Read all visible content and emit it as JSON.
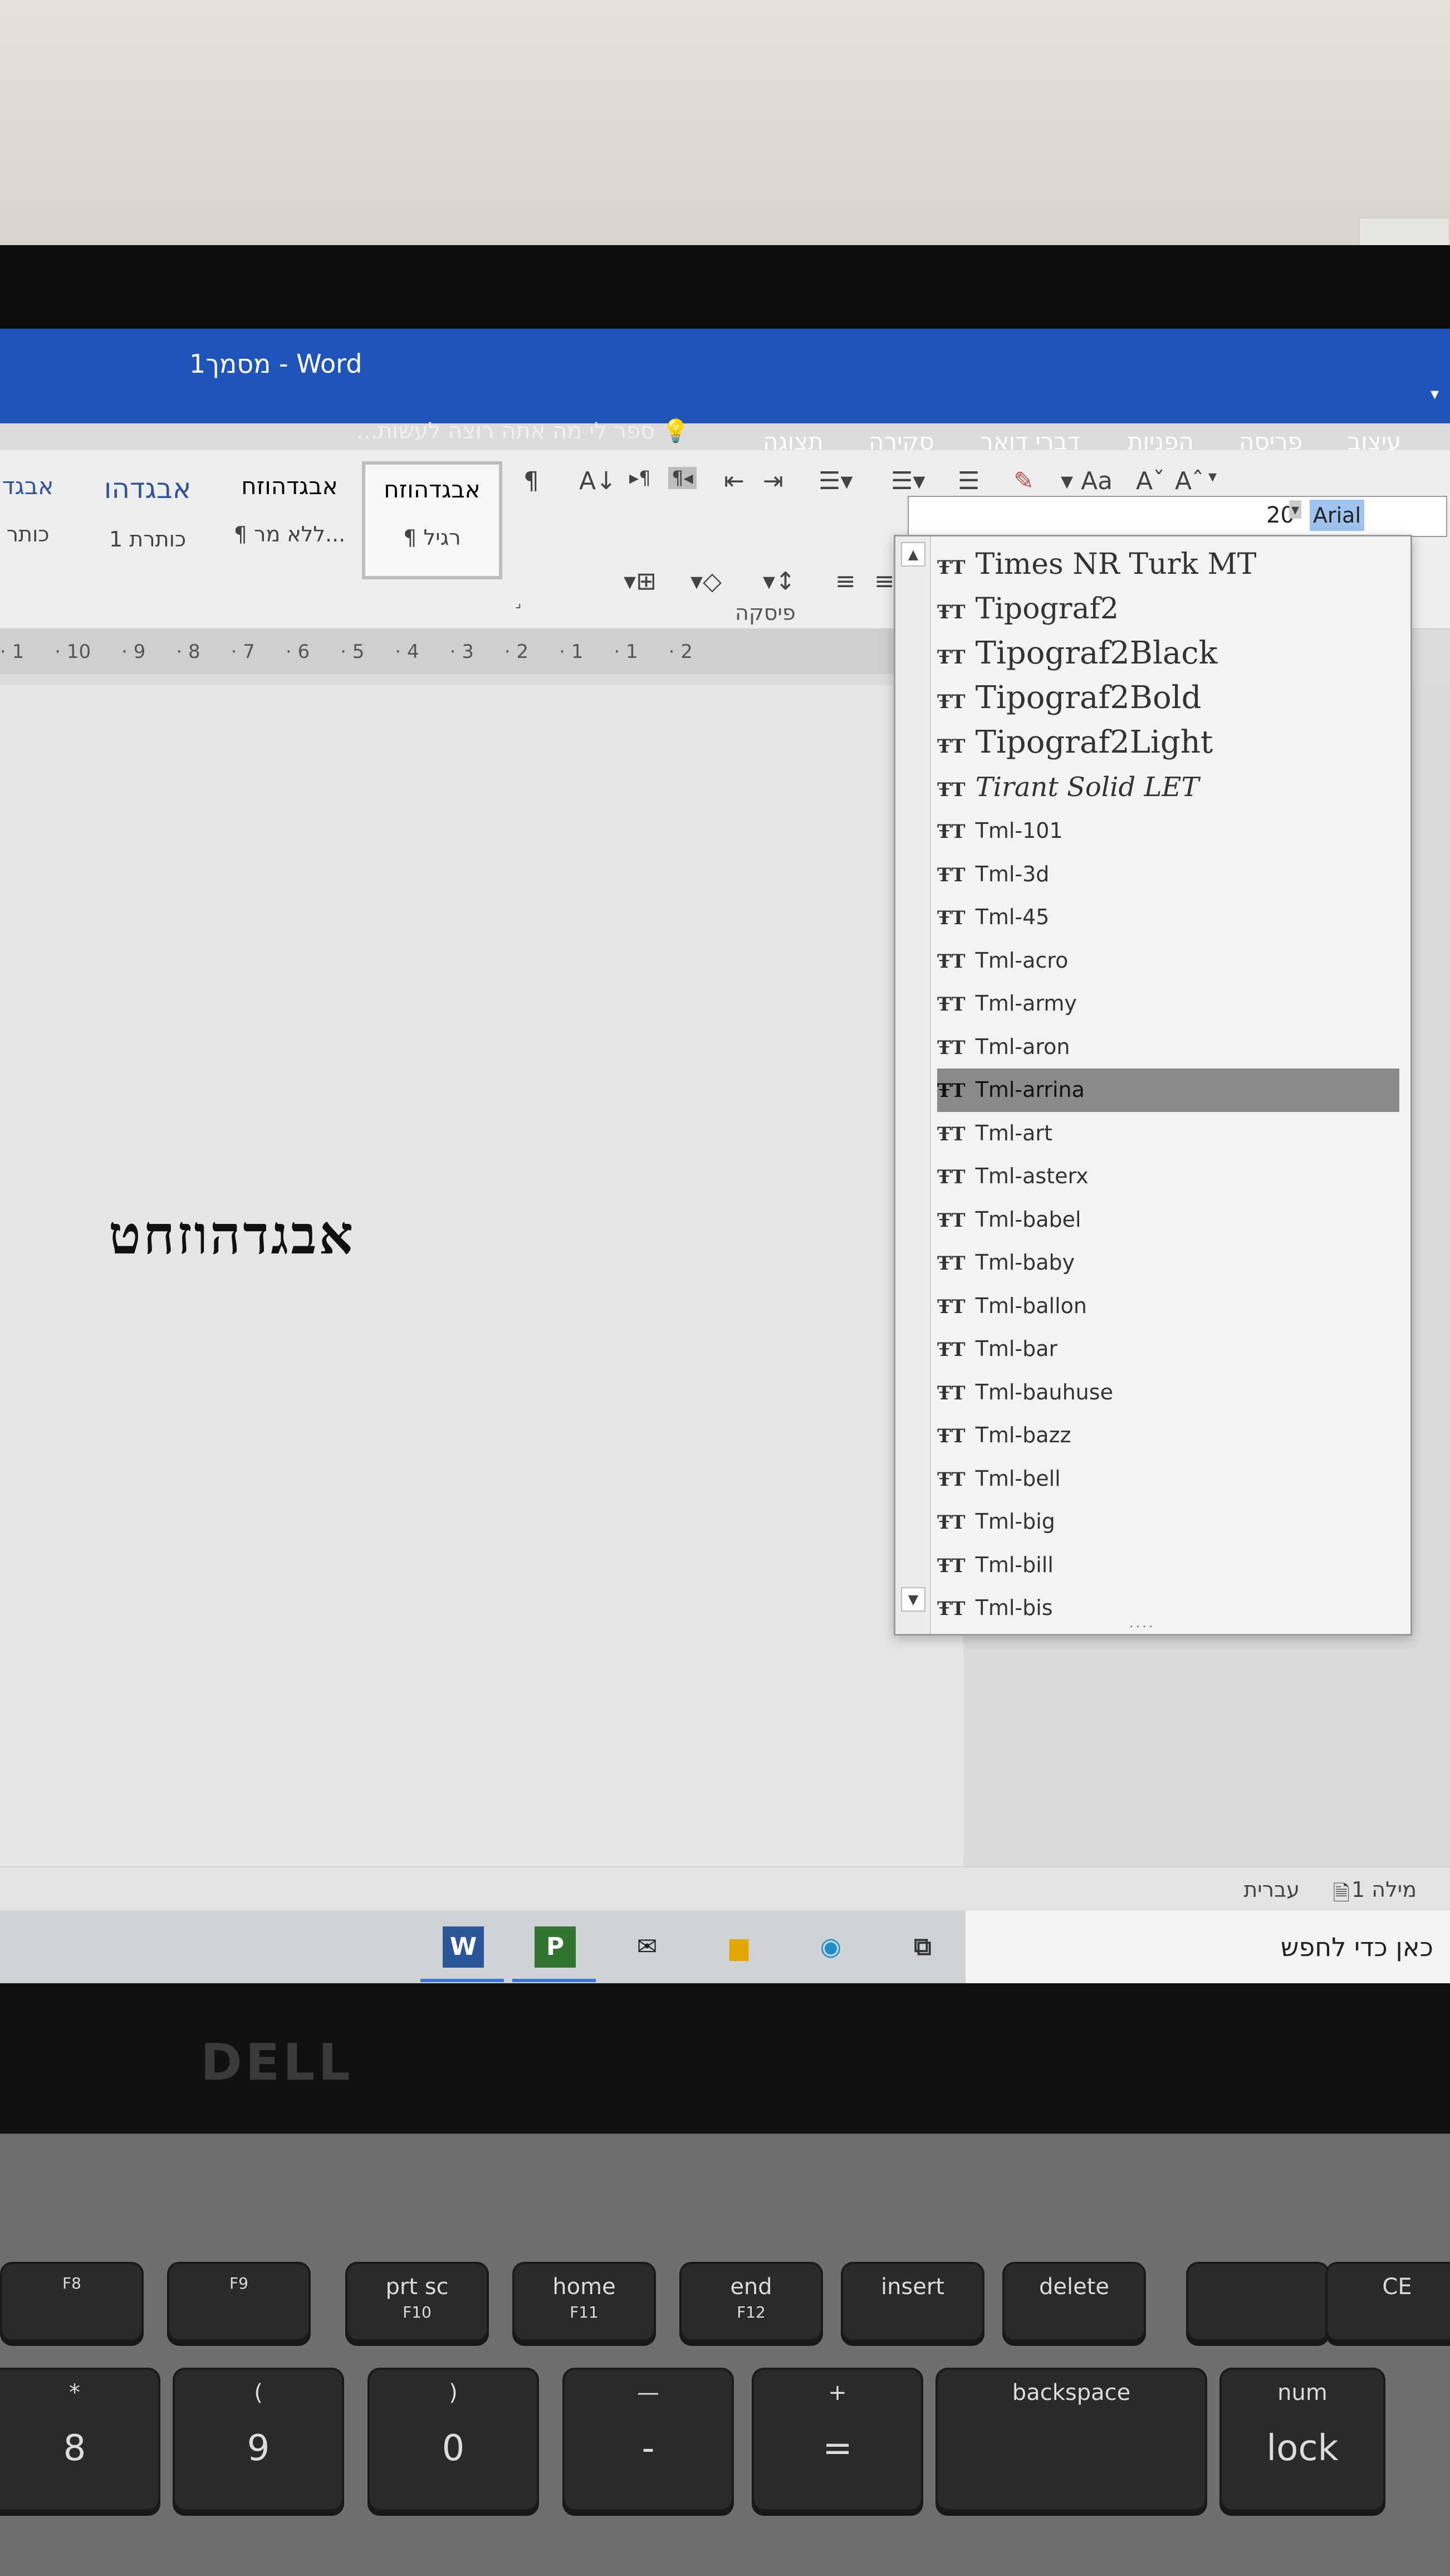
{
  "window": {
    "title": "מסמך1 - Word"
  },
  "tell_me": "ספר לי מה אתה רוצה לעשות...",
  "tabs": [
    "עיצוב",
    "פריסה",
    "הפניות",
    "דברי דואר",
    "סקירה",
    "תצוגה"
  ],
  "styles": [
    {
      "sample": "אבגדהוזח",
      "name": "¶ רגיל"
    },
    {
      "sample": "אבגדהוזח",
      "name": "¶ ללא מר..."
    },
    {
      "sample": "אבגדהו",
      "name": "כותרת 1"
    },
    {
      "sample": "אבגד",
      "name": "כותר"
    }
  ],
  "group_labels": {
    "paragraph": "פיסקה"
  },
  "ruler_text": [
    "1",
    "10",
    "9",
    "8",
    "7",
    "6",
    "5",
    "4",
    "3",
    "2",
    "1",
    "1",
    "2"
  ],
  "font": {
    "size": "20",
    "name": "Arial",
    "name_display": "Arial",
    "grow_label": "A",
    "shrink_label": "A",
    "case_label": "Aa"
  },
  "document": {
    "text": "אבגדהוזחט"
  },
  "font_list": [
    {
      "name": "Times NR Turk MT"
    },
    {
      "name": "Tipograf2"
    },
    {
      "name": "Tipograf2Black"
    },
    {
      "name": "Tipograf2Bold"
    },
    {
      "name": "Tipograf2Light"
    },
    {
      "name": "Tirant Solid LET"
    },
    {
      "name": "Tml-101"
    },
    {
      "name": "Tml-3d"
    },
    {
      "name": "Tml-45"
    },
    {
      "name": "Tml-acro"
    },
    {
      "name": "Tml-army"
    },
    {
      "name": "Tml-aron"
    },
    {
      "name": "Tml-arrina"
    },
    {
      "name": "Tml-art"
    },
    {
      "name": "Tml-asterx"
    },
    {
      "name": "Tml-babel"
    },
    {
      "name": "Tml-baby"
    },
    {
      "name": "Tml-ballon"
    },
    {
      "name": "Tml-bar"
    },
    {
      "name": "Tml-bauhuse"
    },
    {
      "name": "Tml-bazz"
    },
    {
      "name": "Tml-bell"
    },
    {
      "name": "Tml-big"
    },
    {
      "name": "Tml-bill"
    },
    {
      "name": "Tml-bis"
    }
  ],
  "font_list_selected": "Tml-arrina",
  "status": {
    "words": "מילה 1",
    "language": "עברית"
  },
  "taskbar": {
    "search": "כאן כדי לחפש",
    "apps": [
      "W",
      "P",
      "mail",
      "folder",
      "edge",
      "taskview"
    ]
  },
  "laptop_brand": "DELL",
  "keys": [
    {
      "top": "",
      "sub": "F8"
    },
    {
      "top": "",
      "sub": "F9"
    },
    {
      "top": "prt sc",
      "sub": "F10"
    },
    {
      "top": "home",
      "sub": "F11"
    },
    {
      "top": "end",
      "sub": "F12"
    },
    {
      "top": "insert",
      "sub": ""
    },
    {
      "top": "delete",
      "sub": ""
    },
    {
      "top": "",
      "sub": ""
    },
    {
      "top": "CE",
      "sub": ""
    },
    {
      "top": "*",
      "sub": "8"
    },
    {
      "top": "(",
      "sub": "9"
    },
    {
      "top": ")",
      "sub": "0"
    },
    {
      "top": "—",
      "sub": "-"
    },
    {
      "top": "+",
      "sub": "="
    },
    {
      "top": "backspace",
      "sub": ""
    },
    {
      "top": "num",
      "sub": "lock"
    }
  ],
  "colors": {
    "title_bar": "#1f55b8",
    "selected_item": "#8a8a8a",
    "font_highlight": "#9fc2ef"
  }
}
